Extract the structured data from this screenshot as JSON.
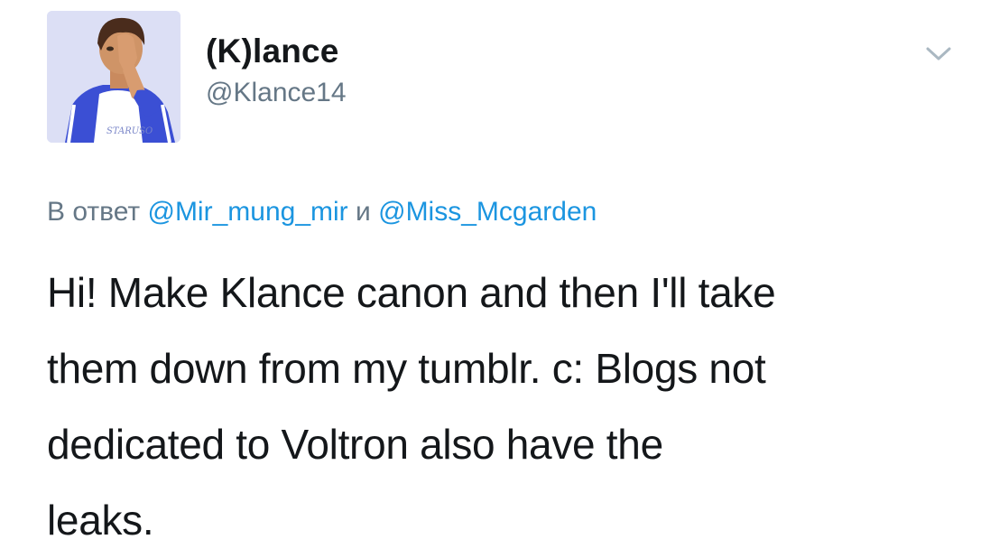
{
  "author": {
    "display_name": "(K)lance",
    "handle": "@Klance14",
    "avatar_icon": "avatar-illustration"
  },
  "menu_icon": "chevron-down-icon",
  "reply": {
    "prefix": "В ответ",
    "mention_1": "@Mir_mung_mir",
    "conjunction": "и",
    "mention_2": "@Miss_Mcgarden"
  },
  "tweet": {
    "lines": [
      "Hi! Make Klance canon and then I'll take",
      "them down from my tumblr. c: Blogs not",
      "dedicated to Voltron also have the",
      "leaks."
    ]
  },
  "colors": {
    "text": "#14171a",
    "secondary": "#657786",
    "link": "#1b95e0",
    "avatar_bg": "#d9dcf3"
  }
}
